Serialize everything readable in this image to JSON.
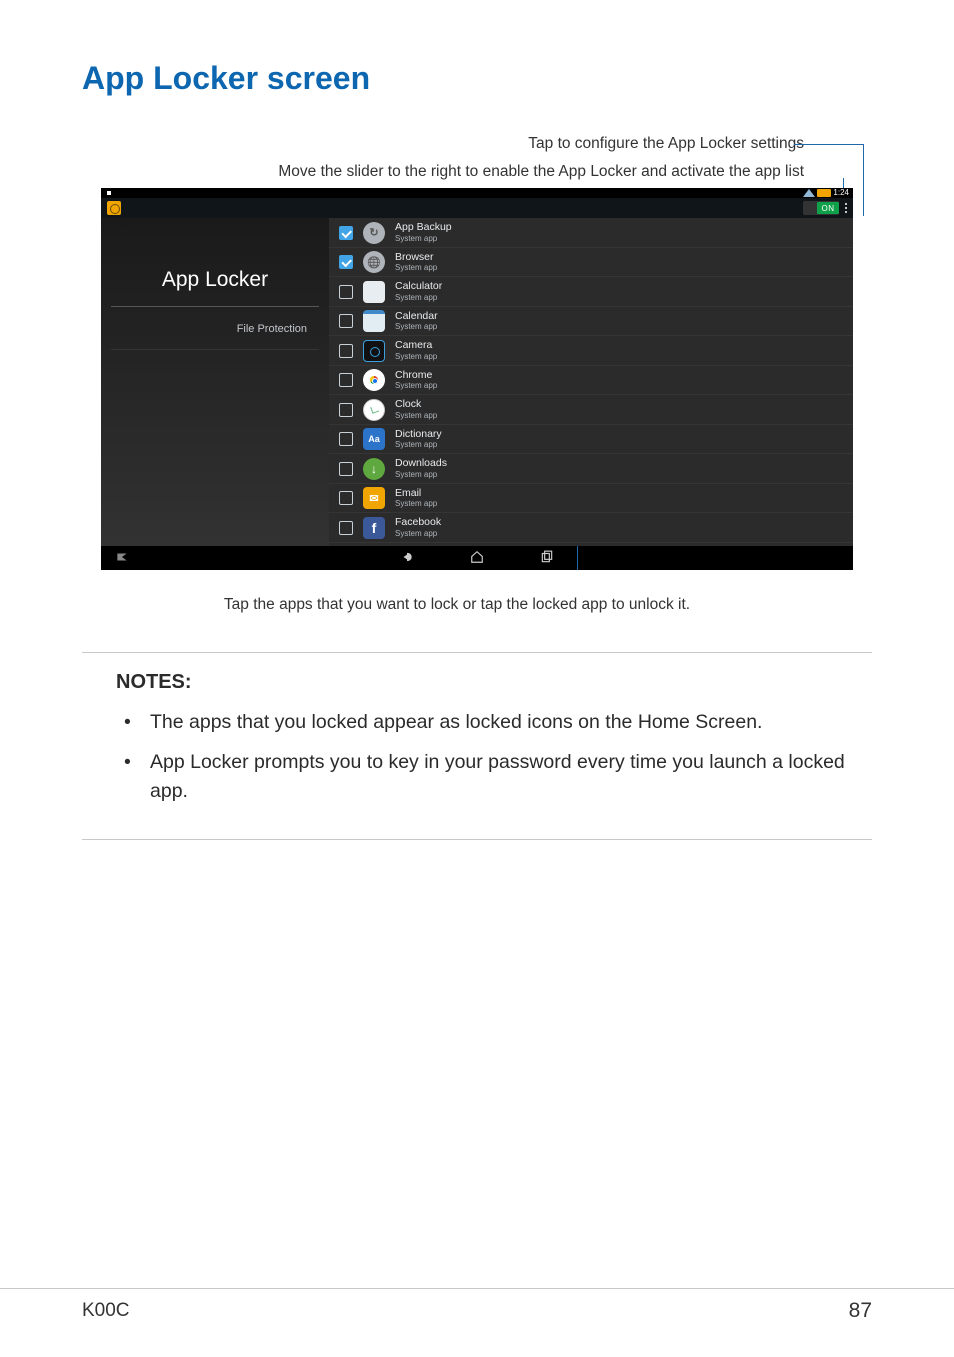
{
  "title": "App Locker screen",
  "callouts": {
    "top1": "Tap to configure the App Locker settings",
    "top2": "Move the slider to the right to enable the App Locker and activate the app list",
    "bottom": "Tap the apps that you want to lock or tap the locked app to unlock it."
  },
  "statusbar": {
    "time": "1:24"
  },
  "notif": {
    "toggle_label": "ON"
  },
  "sidebar": {
    "title": "App Locker",
    "file_protection": "File Protection"
  },
  "apps": [
    {
      "name": "App Backup",
      "sub": "System app",
      "checked": true,
      "icon": "backup-icon",
      "iconClass": "ico-backup"
    },
    {
      "name": "Browser",
      "sub": "System app",
      "checked": true,
      "icon": "browser-icon",
      "iconClass": "ico-browser"
    },
    {
      "name": "Calculator",
      "sub": "System app",
      "checked": false,
      "icon": "calculator-icon",
      "iconClass": "ico-calc"
    },
    {
      "name": "Calendar",
      "sub": "System app",
      "checked": false,
      "icon": "calendar-icon",
      "iconClass": "ico-calendar"
    },
    {
      "name": "Camera",
      "sub": "System app",
      "checked": false,
      "icon": "camera-icon",
      "iconClass": "ico-camera"
    },
    {
      "name": "Chrome",
      "sub": "System app",
      "checked": false,
      "icon": "chrome-icon",
      "iconClass": "ico-chrome"
    },
    {
      "name": "Clock",
      "sub": "System app",
      "checked": false,
      "icon": "clock-icon",
      "iconClass": "ico-clock"
    },
    {
      "name": "Dictionary",
      "sub": "System app",
      "checked": false,
      "icon": "dictionary-icon",
      "iconClass": "ico-dict"
    },
    {
      "name": "Downloads",
      "sub": "System app",
      "checked": false,
      "icon": "downloads-icon",
      "iconClass": "ico-down"
    },
    {
      "name": "Email",
      "sub": "System app",
      "checked": false,
      "icon": "email-icon",
      "iconClass": "ico-email"
    },
    {
      "name": "Facebook",
      "sub": "System app",
      "checked": false,
      "icon": "facebook-icon",
      "iconClass": "ico-fb"
    }
  ],
  "notes": {
    "heading": "NOTES:",
    "items": [
      "The apps that you locked appear as locked icons on the Home Screen.",
      "App Locker prompts you to key in your password every time you launch a locked app."
    ]
  },
  "footer": {
    "left": "K00C",
    "right": "87"
  }
}
